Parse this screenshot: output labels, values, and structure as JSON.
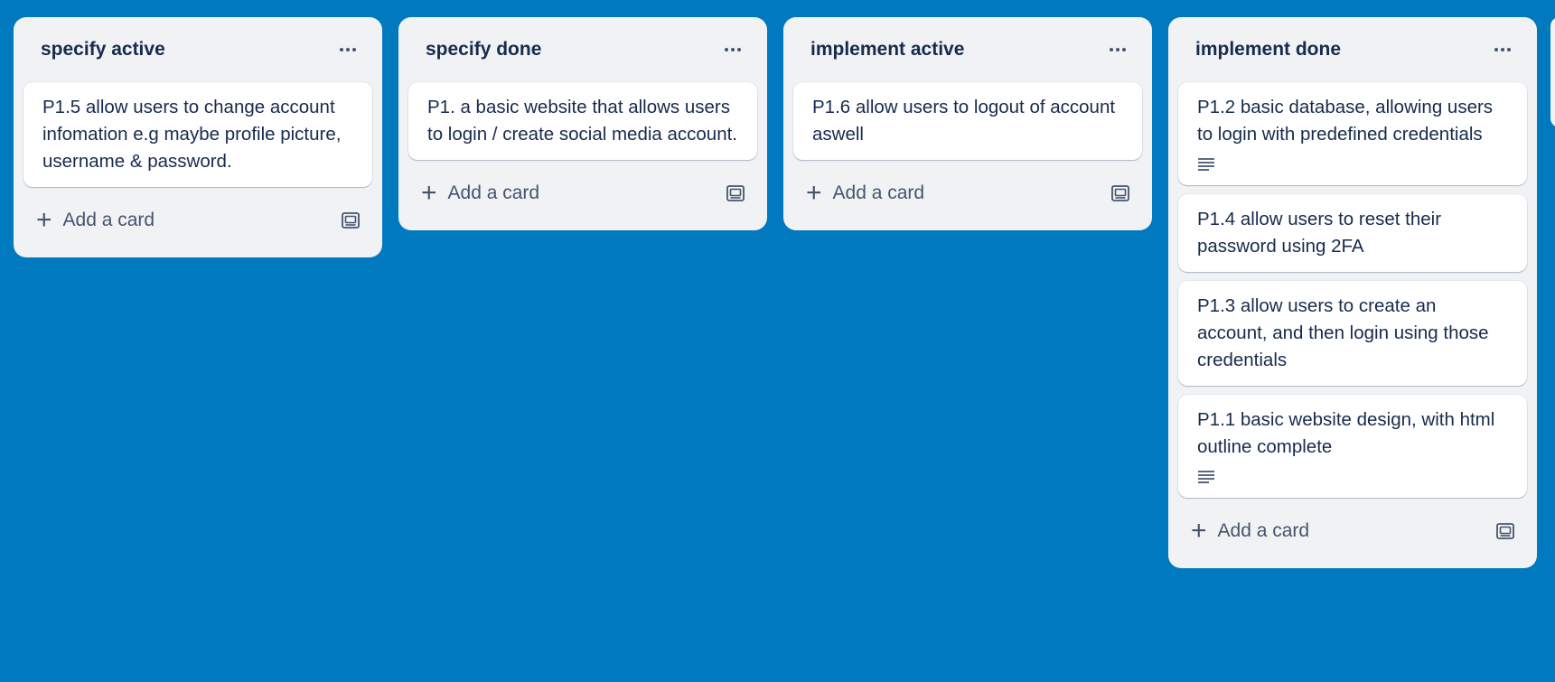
{
  "lists": [
    {
      "title": "specify active",
      "cards": [
        {
          "text": "P1.5 allow users to change account infomation e.g maybe profile picture, username & password.",
          "has_description": false
        }
      ],
      "add_label": "Add a card"
    },
    {
      "title": "specify done",
      "cards": [
        {
          "text": "P1. a basic website that allows users to login / create social media account.",
          "has_description": false
        }
      ],
      "add_label": "Add a card"
    },
    {
      "title": "implement active",
      "cards": [
        {
          "text": "P1.6 allow users to logout of account aswell",
          "has_description": false
        }
      ],
      "add_label": "Add a card"
    },
    {
      "title": "implement done",
      "cards": [
        {
          "text": "P1.2 basic database, allowing users to login with predefined credentials",
          "has_description": true
        },
        {
          "text": "P1.4 allow users to reset their password using 2FA",
          "has_description": false
        },
        {
          "text": "P1.3 allow users to create an account, and then login using those credentials",
          "has_description": false
        },
        {
          "text": "P1.1 basic website design, with html outline complete",
          "has_description": true
        }
      ],
      "add_label": "Add a card"
    }
  ],
  "icons": {
    "list_menu": "ellipsis-icon",
    "add": "plus-icon",
    "template": "card-template-icon",
    "description": "description-icon"
  },
  "colors": {
    "board_background": "#0079bf",
    "list_background": "#f1f2f4",
    "card_background": "#ffffff",
    "text": "#172b4d",
    "muted_text": "#44546f"
  }
}
